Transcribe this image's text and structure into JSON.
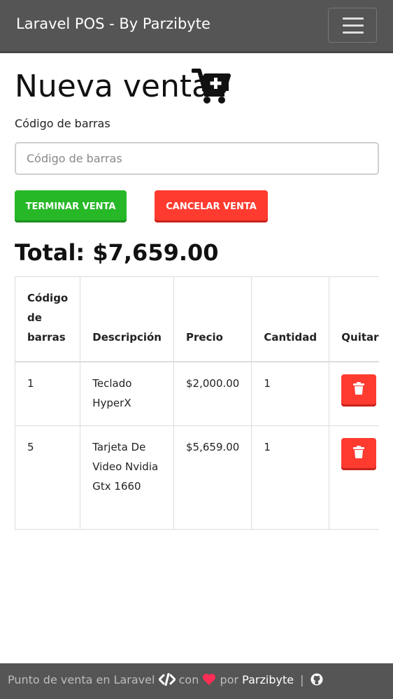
{
  "navbar": {
    "brand": "Laravel POS - By Parzibyte",
    "toggle_icon": "hamburger-menu-icon"
  },
  "page": {
    "title": "Nueva venta",
    "title_icon": "cart-plus-icon"
  },
  "barcode": {
    "label": "Código de barras",
    "placeholder": "Código de barras",
    "value": ""
  },
  "actions": {
    "finish_label": "TERMINAR VENTA",
    "cancel_label": "CANCELAR VENTA"
  },
  "total": {
    "label": "Total: $7,659.00"
  },
  "table": {
    "headers": [
      "Código de barras",
      "Descripción",
      "Precio",
      "Cantidad",
      "Quitar"
    ],
    "rows": [
      {
        "code": "1",
        "description": "Teclado HyperX",
        "price": "$2,000.00",
        "quantity": "1",
        "remove_icon": "trash-icon"
      },
      {
        "code": "5",
        "description": "Tarjeta De Video Nvidia Gtx 1660",
        "price": "$5,659.00",
        "quantity": "1",
        "remove_icon": "trash-icon"
      }
    ]
  },
  "footer": {
    "text1": "Punto de venta en Laravel",
    "code_icon": "code-icon",
    "text2": "con",
    "heart_icon": "heart-icon",
    "text3": "por",
    "author": "Parzibyte",
    "separator": "|",
    "github_icon": "github-icon"
  },
  "colors": {
    "navbar": "#555555",
    "success": "#27b827",
    "danger": "#ff3b30",
    "heart": "#ff2d55"
  }
}
